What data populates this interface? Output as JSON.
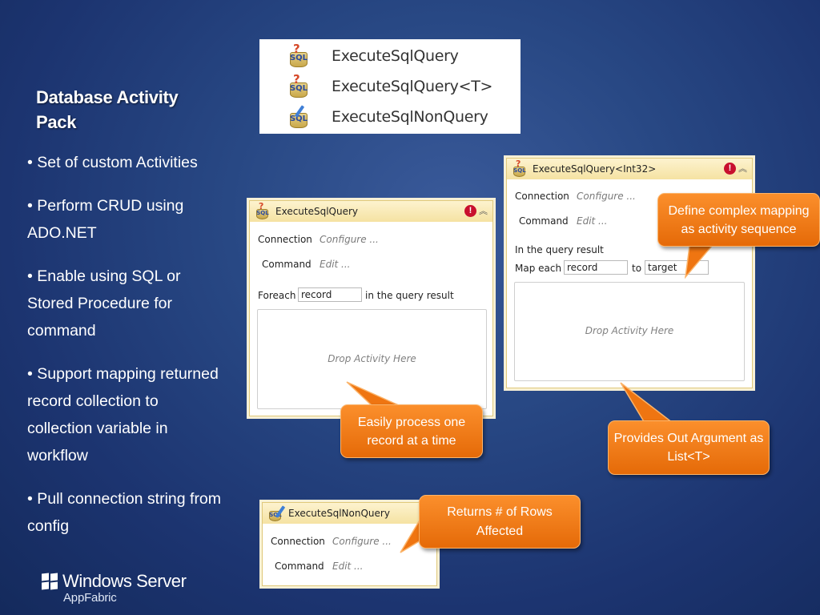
{
  "slide": {
    "title": "Database Activity Pack",
    "bullets": [
      "Set of custom Activities",
      "Perform CRUD using ADO.NET",
      "Enable using SQL or Stored Procedure for command",
      "Support mapping returned record collection to collection variable in workflow",
      "Pull connection string from config"
    ]
  },
  "toolbox": {
    "items": [
      {
        "label": "ExecuteSqlQuery",
        "icon": "sql-query-icon"
      },
      {
        "label": "ExecuteSqlQuery<T>",
        "icon": "sql-query-icon"
      },
      {
        "label": "ExecuteSqlNonQuery",
        "icon": "sql-nonquery-icon"
      }
    ]
  },
  "activity_query": {
    "title": "ExecuteSqlQuery",
    "connection_label": "Connection",
    "connection_value": "Configure ...",
    "command_label": "Command",
    "command_value": "Edit ...",
    "foreach_label": "Foreach",
    "foreach_value": "record",
    "foreach_suffix": "in the query result",
    "drop_text": "Drop Activity Here"
  },
  "activity_query_t": {
    "title": "ExecuteSqlQuery<Int32>",
    "connection_label": "Connection",
    "connection_value": "Configure ...",
    "command_label": "Command",
    "command_value": "Edit ...",
    "result_label": "In the query result",
    "map_label": "Map each",
    "map_value": "record",
    "to_label": "to",
    "to_value": "target",
    "drop_text": "Drop Activity Here"
  },
  "activity_nonquery": {
    "title": "ExecuteSqlNonQuery",
    "connection_label": "Connection",
    "connection_value": "Configure ...",
    "command_label": "Command",
    "command_value": "Edit ..."
  },
  "callouts": {
    "define_mapping": "Define complex mapping as activity sequence",
    "process_record": "Easily process one record at a time",
    "out_argument": "Provides Out Argument as List<T>",
    "rows_affected": "Returns # of Rows Affected"
  },
  "logo": {
    "main": "Windows Server",
    "sub": "AppFabric"
  },
  "colors": {
    "background": "#284884",
    "callout": "#f47b16",
    "header": "#f5e2a2",
    "error": "#c8102e"
  }
}
